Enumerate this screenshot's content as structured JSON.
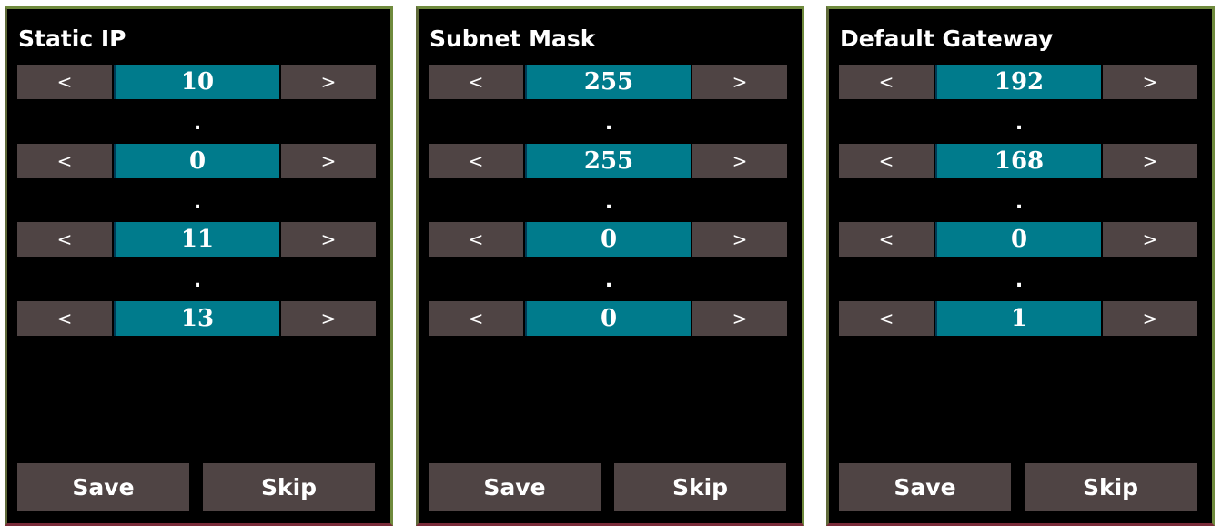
{
  "panels": [
    {
      "title": "Static IP",
      "octets": [
        "10",
        "0",
        "11",
        "13"
      ],
      "separator": ".",
      "decrement_label": "<",
      "increment_label": ">",
      "save_label": "Save",
      "skip_label": "Skip"
    },
    {
      "title": "Subnet Mask",
      "octets": [
        "255",
        "255",
        "0",
        "0"
      ],
      "separator": ".",
      "decrement_label": "<",
      "increment_label": ">",
      "save_label": "Save",
      "skip_label": "Skip"
    },
    {
      "title": "Default Gateway",
      "octets": [
        "192",
        "168",
        "0",
        "1"
      ],
      "separator": ".",
      "decrement_label": "<",
      "increment_label": ">",
      "save_label": "Save",
      "skip_label": "Skip"
    }
  ],
  "colors": {
    "background": "#000000",
    "button": "#4f4444",
    "value_field": "#007b8c",
    "text": "#ffffff"
  }
}
